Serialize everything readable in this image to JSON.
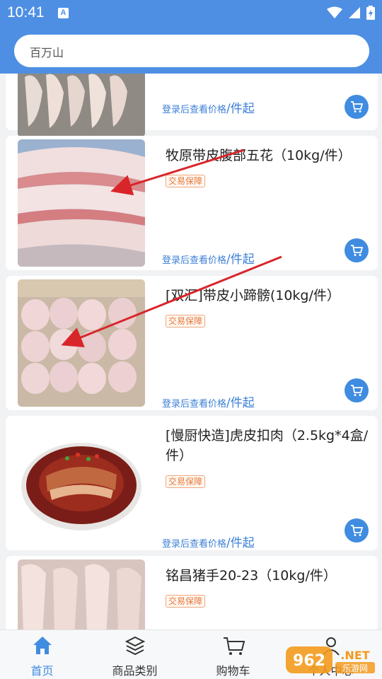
{
  "status_bar": {
    "time": "10:41",
    "app_badge": "A"
  },
  "search": {
    "text": "百万山"
  },
  "products": [
    {
      "title": "",
      "price_note": "登录后查看价格",
      "price_unit": "/件起"
    },
    {
      "title": "牧原带皮腹部五花（10kg/件）",
      "badge": "交易保障",
      "price_note": "登录后查看价格",
      "price_unit": "/件起"
    },
    {
      "title": "[双汇]带皮小蹄髈(10kg/件）",
      "badge": "交易保障",
      "price_note": "登录后查看价格",
      "price_unit": "/件起"
    },
    {
      "title": "[慢厨快造]虎皮扣肉（2.5kg*4盒/件）",
      "badge": "交易保障",
      "price_note": "登录后查看价格",
      "price_unit": "/件起"
    },
    {
      "title": "铭昌猪手20-23（10kg/件）",
      "badge": "交易保障"
    }
  ],
  "nav": [
    {
      "label": "首页",
      "icon": "home-icon",
      "active": true
    },
    {
      "label": "商品类别",
      "icon": "layers-icon"
    },
    {
      "label": "购物车",
      "icon": "cart-icon"
    },
    {
      "label": "个人中心",
      "icon": "user-icon"
    }
  ],
  "watermark": {
    "text": "962.NET",
    "sub": "乐游网"
  },
  "colors": {
    "primary": "#4e8fe4",
    "accent_blue": "#3f8ce0",
    "badge_orange": "#e5793b",
    "arrow_red": "#d8252a"
  }
}
